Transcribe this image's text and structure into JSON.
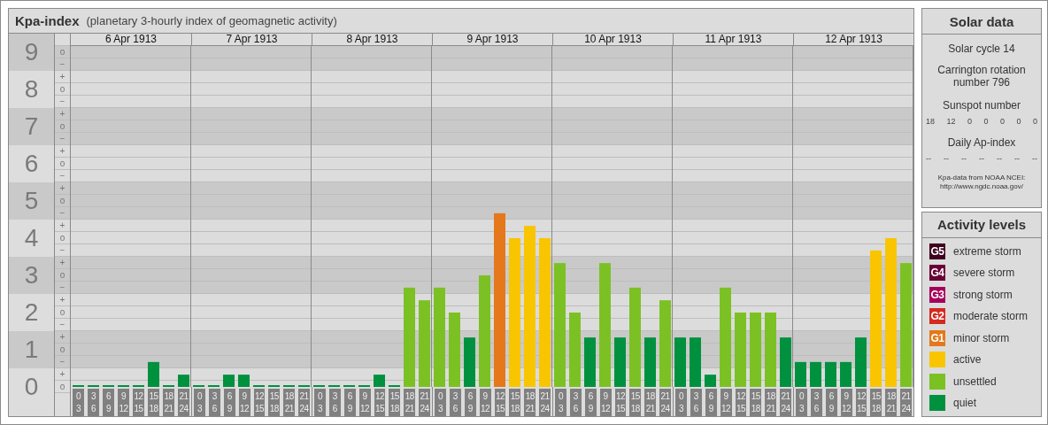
{
  "title": {
    "name": "Kpa-index",
    "subtitle": "(planetary 3-hourly index of geomagnetic activity)"
  },
  "y_axis": [
    {
      "marks": [
        "o",
        "−"
      ]
    },
    {
      "marks": [
        "+",
        "o",
        "−"
      ]
    },
    {
      "marks": [
        "+",
        "o",
        "−"
      ]
    },
    {
      "marks": [
        "+",
        "o",
        "−"
      ]
    },
    {
      "marks": [
        "+",
        "o",
        "−"
      ]
    },
    {
      "marks": [
        "+",
        "o",
        "−"
      ]
    },
    {
      "marks": [
        "+",
        "o",
        "−"
      ]
    },
    {
      "marks": [
        "+",
        "o",
        "−"
      ]
    },
    {
      "marks": [
        "+",
        "o",
        "−"
      ]
    },
    {
      "marks": [
        "+",
        "o"
      ]
    }
  ],
  "days": [
    {
      "date": "6 Apr 1913"
    },
    {
      "date": "7 Apr 1913"
    },
    {
      "date": "8 Apr 1913"
    },
    {
      "date": "9 Apr 1913"
    },
    {
      "date": "10 Apr 1913"
    },
    {
      "date": "11 Apr 1913"
    },
    {
      "date": "12 Apr 1913"
    }
  ],
  "chart_data": {
    "type": "bar",
    "ylim": [
      0,
      9
    ],
    "yticks": [
      0,
      1,
      2,
      3,
      4,
      5,
      6,
      7,
      8,
      9
    ],
    "categories": [
      "0 3",
      "3 6",
      "6 9",
      "9 12",
      "12 15",
      "15 18",
      "18 21",
      "21 24",
      "0 3",
      "3 6",
      "6 9",
      "9 12",
      "12 15",
      "15 18",
      "18 21",
      "21 24",
      "0 3",
      "3 6",
      "6 9",
      "9 12",
      "12 15",
      "15 18",
      "18 21",
      "21 24",
      "0 3",
      "3 6",
      "6 9",
      "9 12",
      "12 15",
      "15 18",
      "18 21",
      "21 24",
      "0 3",
      "3 6",
      "6 9",
      "9 12",
      "12 15",
      "15 18",
      "18 21",
      "21 24",
      "0 3",
      "3 6",
      "6 9",
      "9 12",
      "12 15",
      "15 18",
      "18 21",
      "21 24",
      "0 3",
      "3 6",
      "6 9",
      "9 12",
      "12 15",
      "15 18",
      "18 21",
      "21 24"
    ],
    "series": [
      {
        "color": "#00913f",
        "values": [
          0,
          0,
          0,
          0,
          0,
          0.67,
          0,
          0.33,
          0,
          0,
          0.33,
          0.33,
          0,
          0,
          0,
          0,
          0,
          0,
          0,
          0,
          0.33,
          0,
          null,
          null,
          null,
          null,
          1.33,
          null,
          null,
          null,
          null,
          null,
          null,
          null,
          1.33,
          null,
          1.33,
          null,
          1.33,
          null,
          1.33,
          1.33,
          0.33,
          null,
          null,
          null,
          null,
          1.33,
          0.67,
          0.67,
          0.67,
          0.67,
          1.33,
          null,
          null,
          null
        ]
      },
      {
        "color": "#7cc124",
        "values": [
          null,
          null,
          null,
          null,
          null,
          null,
          null,
          null,
          null,
          null,
          null,
          null,
          null,
          null,
          null,
          null,
          null,
          null,
          null,
          null,
          null,
          null,
          2.67,
          2.33,
          2.67,
          2,
          null,
          3,
          null,
          null,
          null,
          null,
          3.33,
          2,
          null,
          3.33,
          null,
          2.67,
          null,
          2.33,
          null,
          null,
          null,
          2.67,
          2,
          2,
          2,
          null,
          null,
          null,
          null,
          null,
          null,
          null,
          null,
          3.33
        ]
      },
      {
        "color": "#f9c500",
        "values": [
          null,
          null,
          null,
          null,
          null,
          null,
          null,
          null,
          null,
          null,
          null,
          null,
          null,
          null,
          null,
          null,
          null,
          null,
          null,
          null,
          null,
          null,
          null,
          null,
          null,
          null,
          null,
          null,
          null,
          4,
          4.33,
          4,
          null,
          null,
          null,
          null,
          null,
          null,
          null,
          null,
          null,
          null,
          null,
          null,
          null,
          null,
          null,
          null,
          null,
          null,
          null,
          null,
          null,
          3.67,
          4,
          null
        ]
      },
      {
        "color": "#e4781a",
        "values": [
          null,
          null,
          null,
          null,
          null,
          null,
          null,
          null,
          null,
          null,
          null,
          null,
          null,
          null,
          null,
          null,
          null,
          null,
          null,
          null,
          null,
          null,
          null,
          null,
          null,
          null,
          null,
          null,
          4.67,
          null,
          null,
          null,
          null,
          null,
          null,
          null,
          null,
          null,
          null,
          null,
          null,
          null,
          null,
          null,
          null,
          null,
          null,
          null,
          null,
          null,
          null,
          null,
          null,
          null,
          null,
          null
        ]
      }
    ]
  },
  "solar_data": {
    "title": "Solar data",
    "cycle": "Solar cycle 14",
    "rotation": "Carrington rotation number 796",
    "sunspot_label": "Sunspot number",
    "sunspots": [
      "18",
      "12",
      "0",
      "0",
      "0",
      "0",
      "0"
    ],
    "ap_label": "Daily Ap-index",
    "ap_values": [
      "--",
      "--",
      "--",
      "--",
      "--",
      "--",
      "--"
    ],
    "source": "Kpa-data from NOAA NCEI: http://www.ngdc.noaa.gov/"
  },
  "activity_levels": {
    "title": "Activity levels",
    "items": [
      {
        "badge": "G5",
        "label": "extreme storm",
        "color": "#3f0020"
      },
      {
        "badge": "G4",
        "label": "severe storm",
        "color": "#6b0035"
      },
      {
        "badge": "G3",
        "label": "strong storm",
        "color": "#a5005c"
      },
      {
        "badge": "G2",
        "label": "moderate storm",
        "color": "#d52a1e"
      },
      {
        "badge": "G1",
        "label": "minor storm",
        "color": "#e4781a"
      },
      {
        "label": "active",
        "color": "#f9c500"
      },
      {
        "label": "unsettled",
        "color": "#7cc124"
      },
      {
        "label": "quiet",
        "color": "#00913f"
      }
    ]
  }
}
